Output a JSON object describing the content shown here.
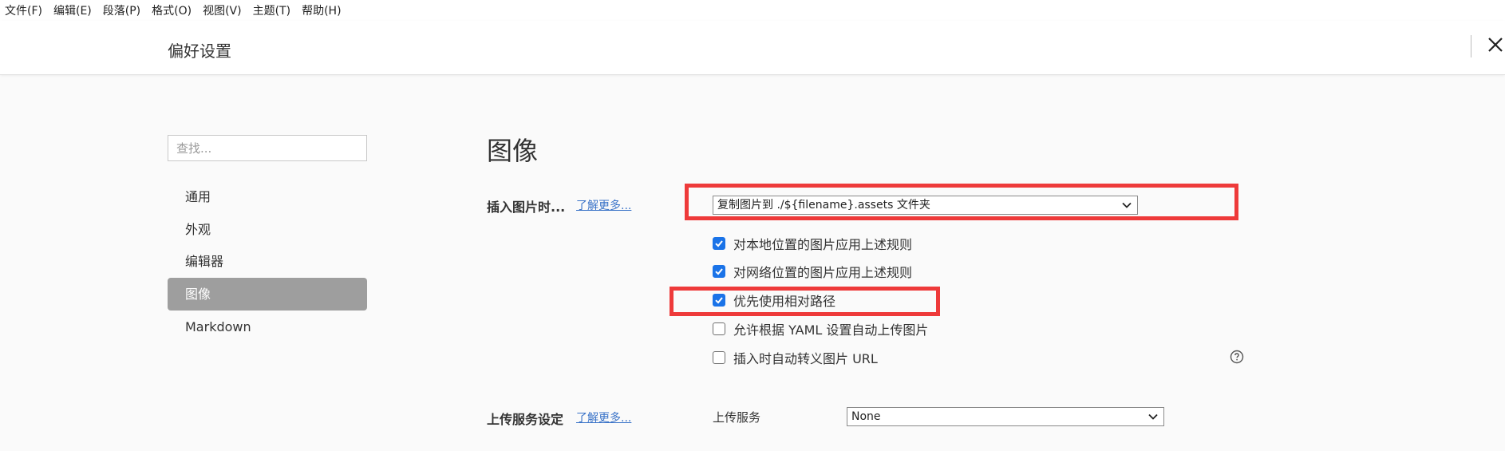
{
  "menubar": [
    "文件(F)",
    "编辑(E)",
    "段落(P)",
    "格式(O)",
    "视图(V)",
    "主题(T)",
    "帮助(H)"
  ],
  "header": {
    "title": "偏好设置",
    "close_icon": "close-icon"
  },
  "sidebar": {
    "search_placeholder": "查找...",
    "items": [
      {
        "label": "通用",
        "active": false
      },
      {
        "label": "外观",
        "active": false
      },
      {
        "label": "编辑器",
        "active": false
      },
      {
        "label": "图像",
        "active": true
      },
      {
        "label": "Markdown",
        "active": false
      }
    ]
  },
  "main": {
    "section_title": "图像",
    "insert_image": {
      "label": "插入图片时...",
      "learn_more": "了解更多...",
      "select_value": "复制图片到 ./${filename}.assets 文件夹"
    },
    "options": [
      {
        "label": "对本地位置的图片应用上述规则",
        "checked": true
      },
      {
        "label": "对网络位置的图片应用上述规则",
        "checked": true
      },
      {
        "label": "优先使用相对路径",
        "checked": true
      },
      {
        "label": "允许根据 YAML 设置自动上传图片",
        "checked": false
      },
      {
        "label": "插入时自动转义图片 URL",
        "checked": false
      }
    ],
    "help_icon": "question-circle-icon",
    "upload": {
      "label": "上传服务设定",
      "learn_more": "了解更多...",
      "service_label": "上传服务",
      "service_value": "None"
    }
  },
  "colors": {
    "highlight": "#ee3a3a",
    "checkbox": "#1a73e8",
    "link": "#3a73c8",
    "active_nav": "#9e9e9e"
  }
}
